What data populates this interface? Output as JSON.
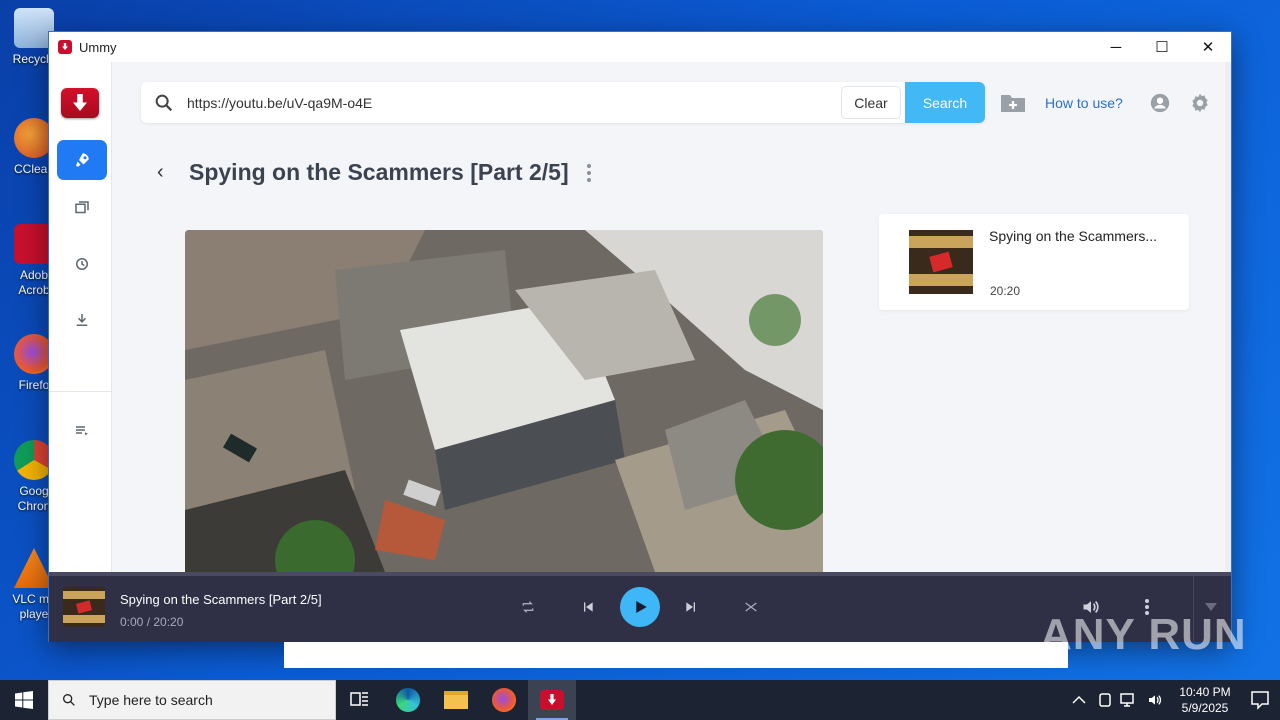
{
  "desktop": {
    "icons": [
      {
        "label": "Recycle",
        "icon": "recycle-bin-icon"
      },
      {
        "label": "CClean",
        "icon": "ccleaner-icon"
      },
      {
        "label": "Adob Acrob",
        "icon": "acrobat-icon"
      },
      {
        "label": "Firefo",
        "icon": "firefox-icon"
      },
      {
        "label": "Goog Chron",
        "icon": "chrome-icon"
      },
      {
        "label": "VLC me playe",
        "icon": "vlc-icon"
      }
    ]
  },
  "window": {
    "title": "Ummy",
    "controls": {
      "minimize": "─",
      "maximize": "☐",
      "close": "✕"
    }
  },
  "search": {
    "value": "https://youtu.be/uV-qa9M-o4E",
    "clear_label": "Clear",
    "search_label": "Search"
  },
  "header": {
    "how_to_label": "How to use?"
  },
  "video": {
    "title": "Spying on the Scammers [Part 2/5]"
  },
  "playlist": {
    "items": [
      {
        "title": "Spying on the Scammers...",
        "duration": "20:20"
      }
    ]
  },
  "player": {
    "title": "Spying on the Scammers [Part 2/5]",
    "time": "0:00 / 20:20",
    "progress": 0
  },
  "taskbar": {
    "search_placeholder": "Type here to search",
    "time": "10:40 PM",
    "date": "5/9/2025"
  },
  "watermark": "ANY RUN",
  "colors": {
    "accent": "#1f7af3",
    "search_button": "#42b8f5",
    "brand_red": "#c8102e",
    "player_bg": "#2f2f46"
  }
}
